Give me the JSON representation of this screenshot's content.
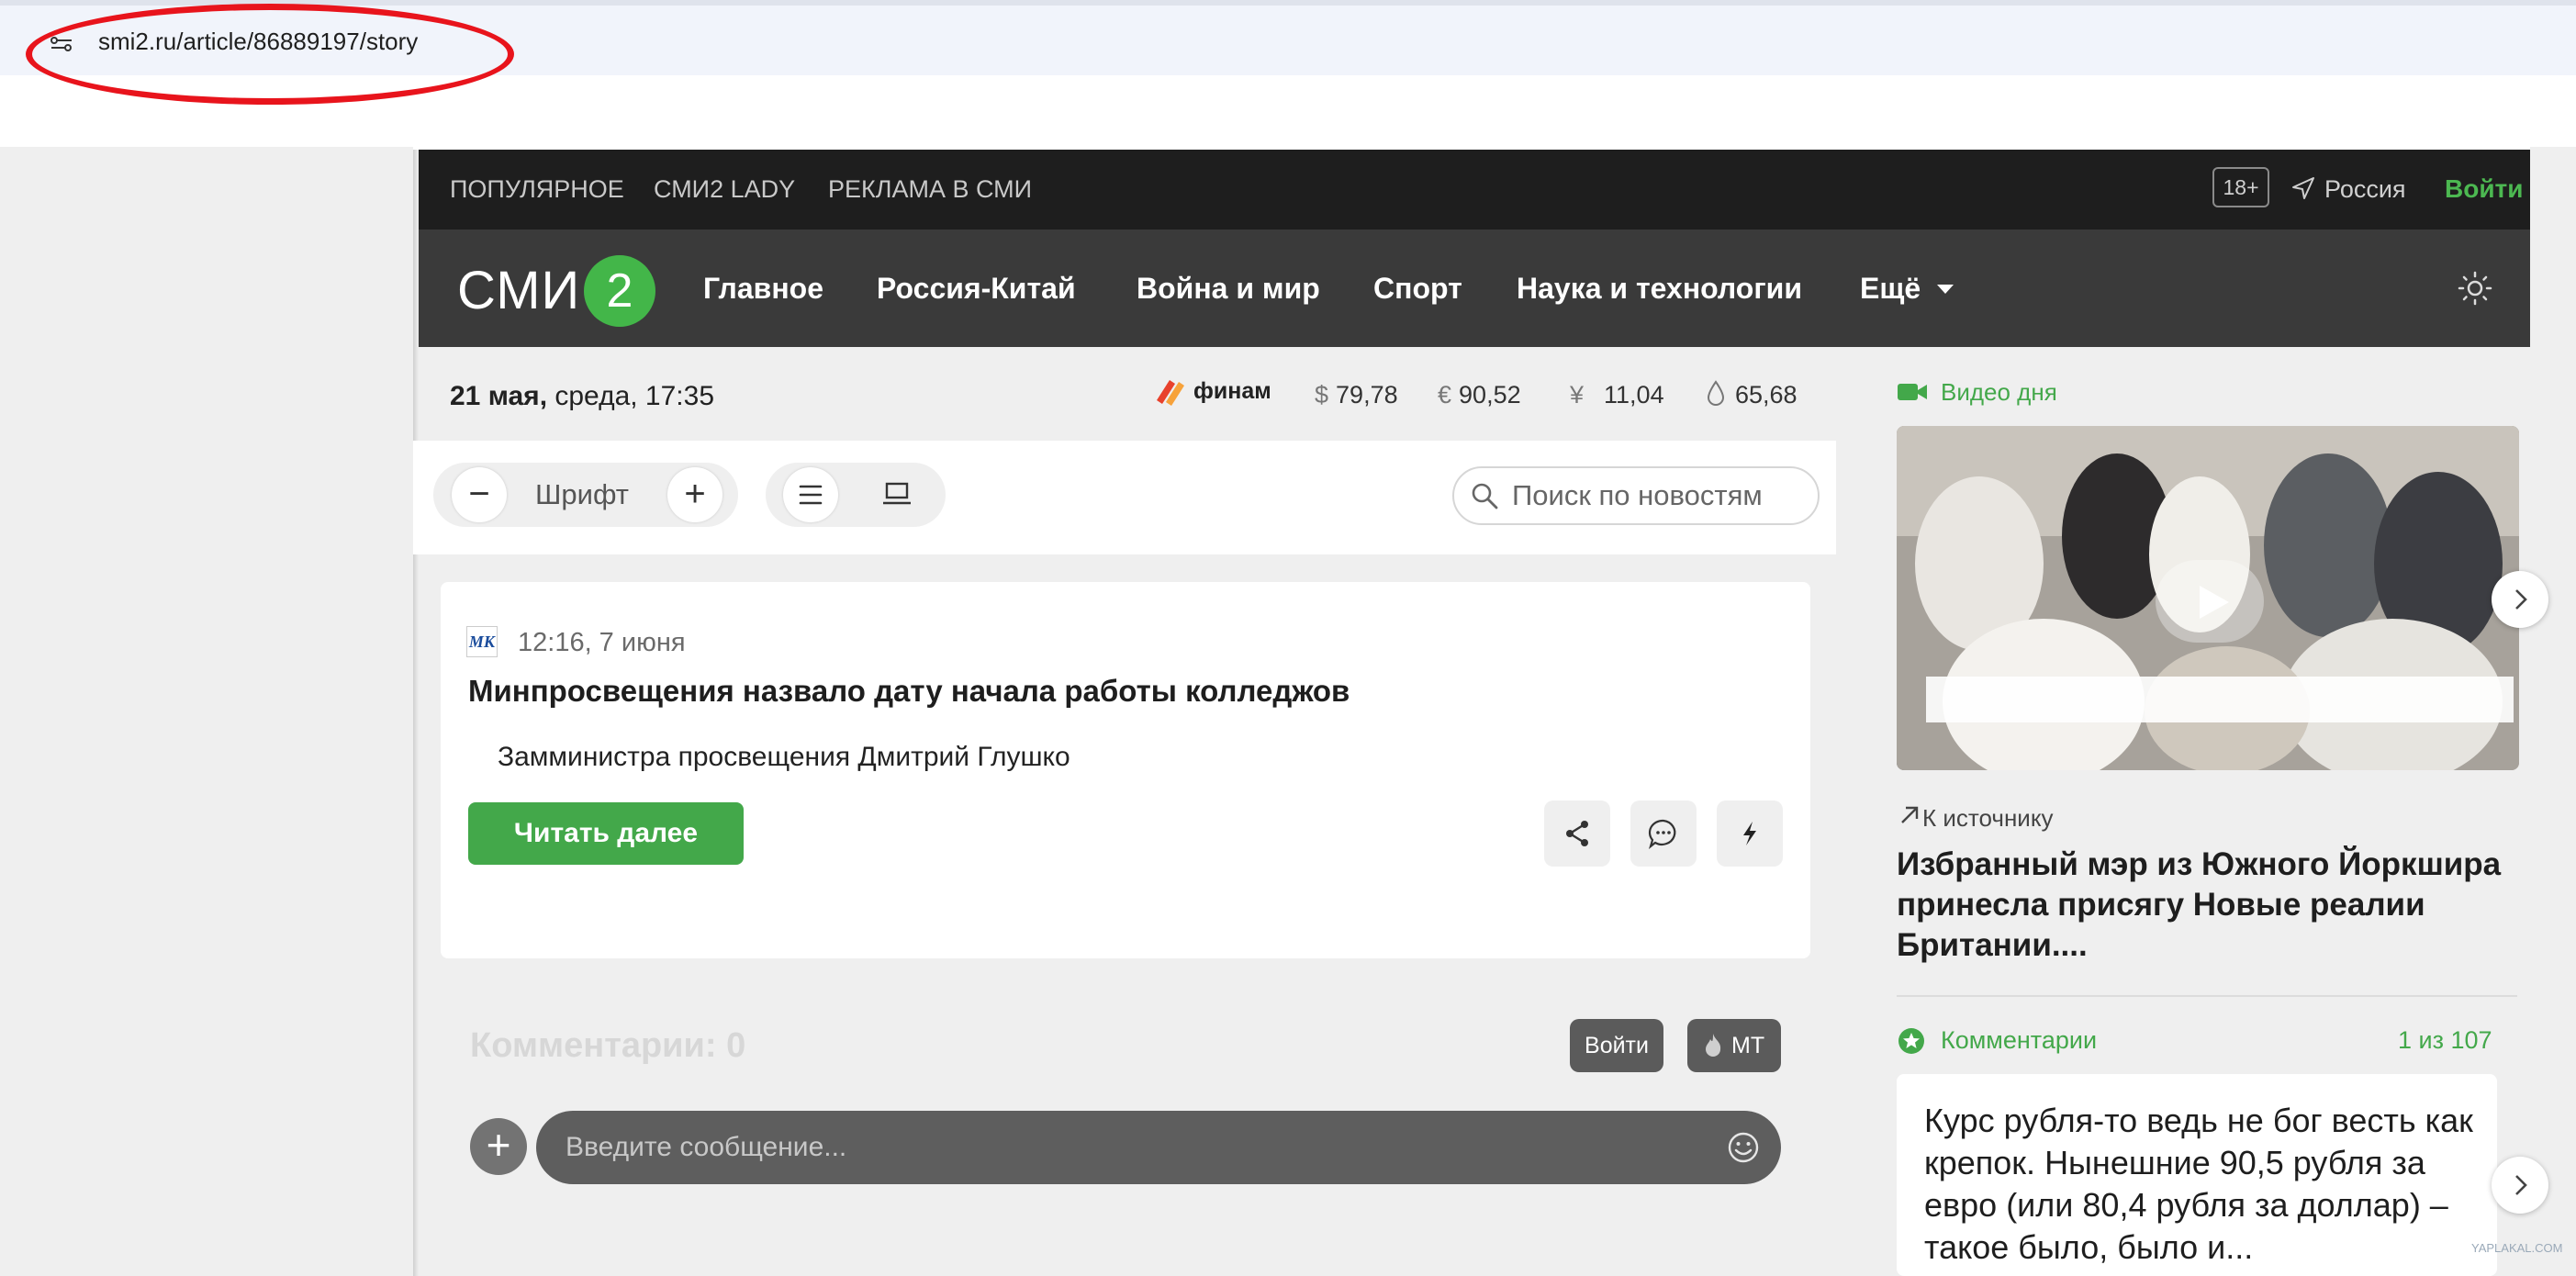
{
  "browser": {
    "url": "smi2.ru/article/86889197/story"
  },
  "topbar": {
    "nav": [
      "ПОПУЛЯРНОЕ",
      "СМИ2 LADY",
      "РЕКЛАМА В СМИ"
    ],
    "age_badge": "18+",
    "region": "Россия",
    "login": "Войти"
  },
  "mainnav": {
    "logo_text": "СМИ",
    "logo_number": "2",
    "items": [
      "Главное",
      "Россия-Китай",
      "Война и мир",
      "Спорт",
      "Наука и технологии",
      "Ещё"
    ],
    "accent": "#43b649"
  },
  "infobar": {
    "date_bold": "21 мая,",
    "date_rest": " среда, 17:35",
    "finam": "финам",
    "rates": [
      {
        "icon": "dollar-icon",
        "symbol": "$",
        "value": "79,78"
      },
      {
        "icon": "euro-icon",
        "symbol": "€",
        "value": "90,52"
      },
      {
        "icon": "yuan-icon",
        "symbol": "¥",
        "value": "11,04"
      },
      {
        "icon": "oil-drop-icon",
        "symbol": "",
        "value": "65,68"
      }
    ]
  },
  "toolbar": {
    "font_label": "Шрифт",
    "minus": "−",
    "plus": "+",
    "search_placeholder": "Поиск по новостям"
  },
  "article": {
    "source_logo": "МК",
    "time": "12:16, 7 июня",
    "title": "Минпросвещения назвало дату начала работы колледжов",
    "lead": "Замминистра просвещения Дмитрий Глушко",
    "read_more": "Читать далее"
  },
  "comments": {
    "title": "Комментарии: 0",
    "login": "Войти",
    "mt": "МТ",
    "add": "+",
    "placeholder": "Введите сообщение..."
  },
  "sidebar": {
    "video_label": "Видео дня",
    "to_source": "К источнику",
    "video_title": "Избранный мэр из Южного Йоркшира принесла присягу Новые реалии Британии....",
    "comments_label": "Комментарии",
    "comments_count": "1 из 107",
    "comment_text": "Курс рубля-то ведь не бог весть как крепок. Нынешние 90,5 рубля за евро (или 80,4 рубля за доллар) – такое было, было и..."
  },
  "watermark": "YAPLAKAL.COM"
}
